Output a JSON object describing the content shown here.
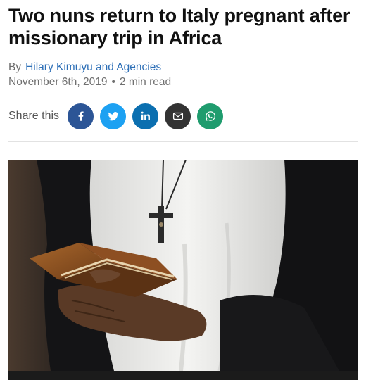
{
  "article": {
    "headline": "Two nuns return to Italy pregnant after missionary trip in Africa",
    "byline_prefix": "By",
    "author": "Hilary Kimuyu and Agencies",
    "date": "November 6th, 2019",
    "separator": "•",
    "read_time": "2 min read"
  },
  "share": {
    "label": "Share this",
    "buttons": [
      {
        "name": "facebook",
        "icon": "facebook-icon",
        "color": "#2c5596"
      },
      {
        "name": "twitter",
        "icon": "twitter-icon",
        "color": "#1da1f2"
      },
      {
        "name": "linkedin",
        "icon": "linkedin-icon",
        "color": "#0b6fb0"
      },
      {
        "name": "email",
        "icon": "mail-icon",
        "color": "#333333"
      },
      {
        "name": "whatsapp",
        "icon": "whatsapp-icon",
        "color": "#1f9c6e"
      }
    ]
  },
  "image": {
    "subject": "nun-holding-book-with-crucifix"
  }
}
